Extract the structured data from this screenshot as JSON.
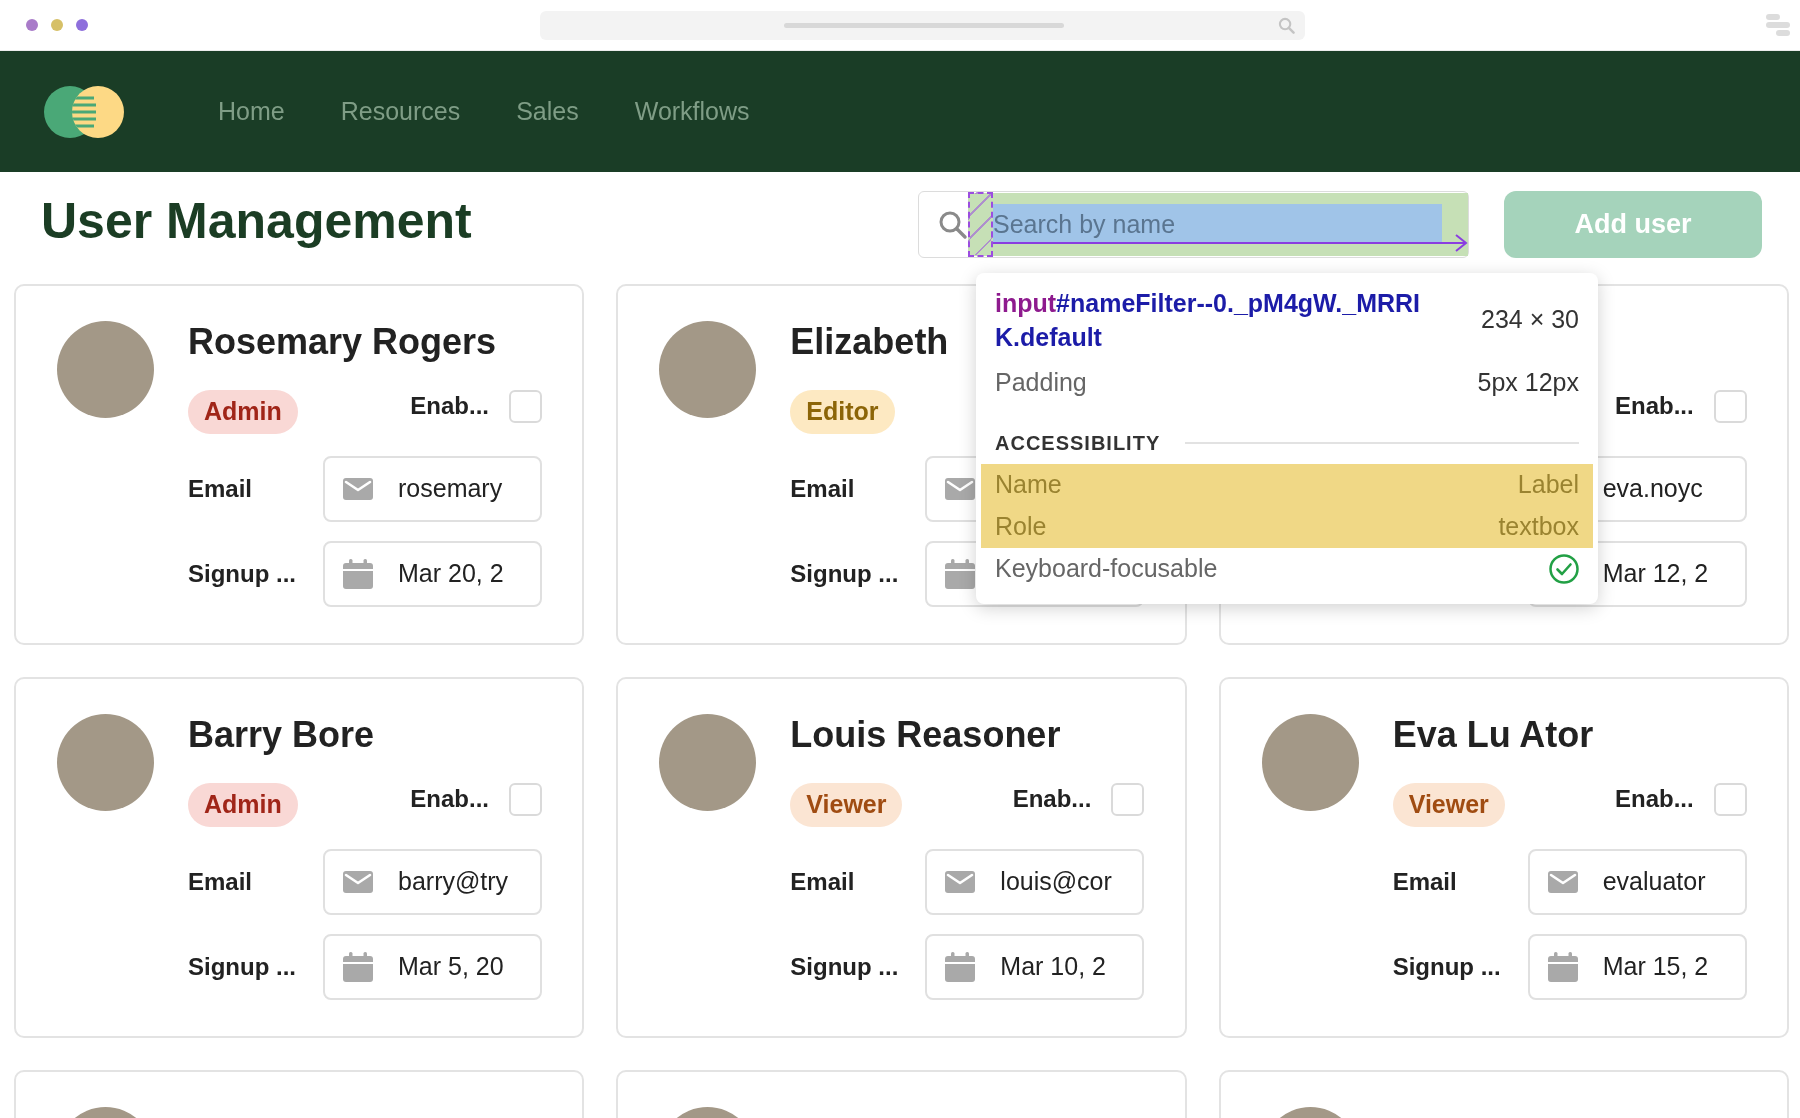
{
  "nav": {
    "items": [
      "Home",
      "Resources",
      "Sales",
      "Workflows"
    ]
  },
  "header": {
    "title": "User Management",
    "search": {
      "placeholder": "Search by name"
    },
    "add_button": "Add user"
  },
  "cards": [
    {
      "avatar": true,
      "name": "Rosemary Rogers",
      "role": {
        "label": "Admin",
        "kind": "admin"
      },
      "toggle": {
        "label": "Enab...",
        "checked": false
      },
      "fields": [
        {
          "kind": "email",
          "label": "Email",
          "value": "rosemary"
        },
        {
          "kind": "date",
          "label": "Signup ...",
          "value": "Mar 20, 2"
        }
      ]
    },
    {
      "avatar": true,
      "name": "Elizabeth",
      "role": {
        "label": "Editor",
        "kind": "editor"
      },
      "fields": [
        {
          "kind": "email",
          "label": "Email"
        },
        {
          "kind": "date",
          "label": "Signup ..."
        }
      ]
    },
    {
      "avatar": false,
      "toggle": {
        "label": "Enab...",
        "checked": false
      },
      "fields": [
        {
          "kind": "email",
          "value": "eva.noyc"
        },
        {
          "kind": "date",
          "value": "Mar 12, 2"
        }
      ]
    },
    {
      "avatar": true,
      "name": "Barry Bore",
      "role": {
        "label": "Admin",
        "kind": "admin"
      },
      "toggle": {
        "label": "Enab...",
        "checked": false
      },
      "fields": [
        {
          "kind": "email",
          "label": "Email",
          "value": "barry@try"
        },
        {
          "kind": "date",
          "label": "Signup ...",
          "value": "Mar 5, 20"
        }
      ]
    },
    {
      "avatar": true,
      "name": "Louis Reasoner",
      "role": {
        "label": "Viewer",
        "kind": "viewer"
      },
      "toggle": {
        "label": "Enab...",
        "checked": false
      },
      "fields": [
        {
          "kind": "email",
          "label": "Email",
          "value": "louis@cor"
        },
        {
          "kind": "date",
          "label": "Signup ...",
          "value": "Mar 10, 2"
        }
      ]
    },
    {
      "avatar": true,
      "name": "Eva Lu Ator",
      "role": {
        "label": "Viewer",
        "kind": "viewer"
      },
      "toggle": {
        "label": "Enab...",
        "checked": false
      },
      "fields": [
        {
          "kind": "email",
          "label": "Email",
          "value": "evaluator"
        },
        {
          "kind": "date",
          "label": "Signup ...",
          "value": "Mar 15, 2"
        }
      ]
    },
    {
      "avatar": true
    },
    {
      "avatar": true
    },
    {
      "avatar": true
    }
  ],
  "inspector": {
    "tag": "input",
    "selector": "#nameFilter--0._pM4gW._MRRIK.default",
    "size": "234 × 30",
    "rows": [
      {
        "label": "Padding",
        "value": "5px 12px"
      }
    ],
    "section": "ACCESSIBILITY",
    "a11y": [
      {
        "kind": "text",
        "label": "Name",
        "value": "Label",
        "highlighted": true
      },
      {
        "kind": "text",
        "label": "Role",
        "value": "textbox",
        "highlighted": true
      },
      {
        "kind": "check",
        "label": "Keyboard-focusable",
        "checked": true,
        "highlighted": false
      }
    ]
  }
}
